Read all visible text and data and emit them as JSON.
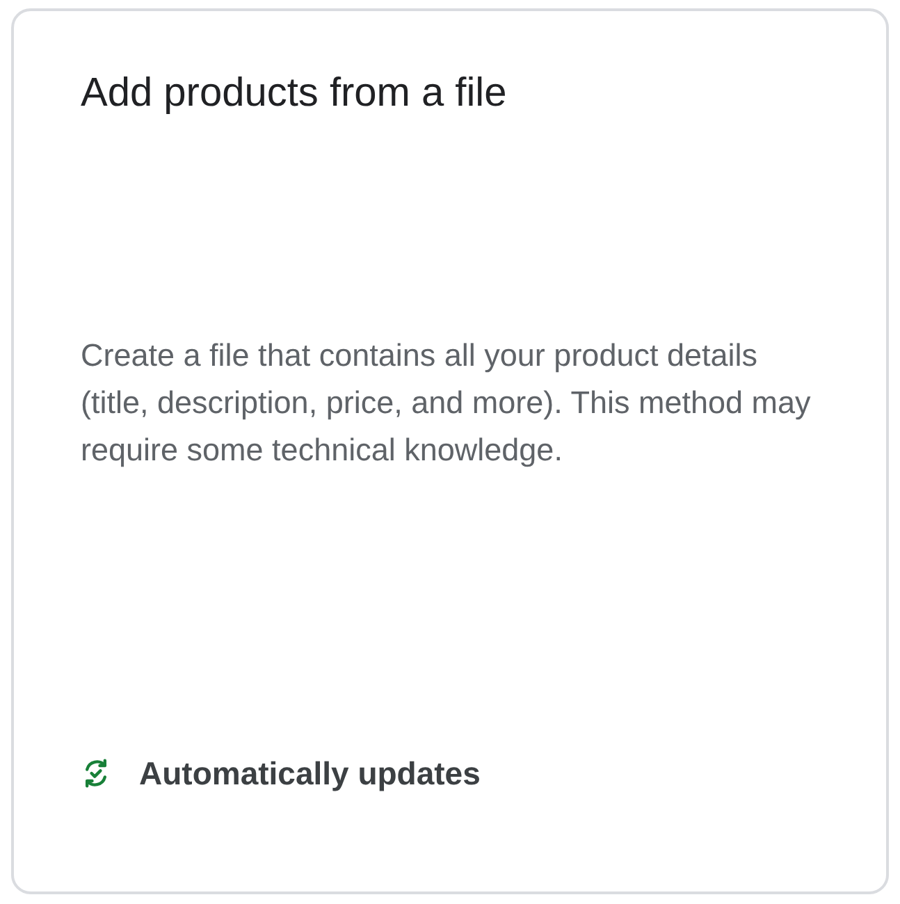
{
  "card": {
    "title": "Add products from a file",
    "description": "Create a file that contains all your product details (title, description, price, and more). This method may require some technical knowledge.",
    "feature": {
      "label": "Automatically updates"
    }
  }
}
